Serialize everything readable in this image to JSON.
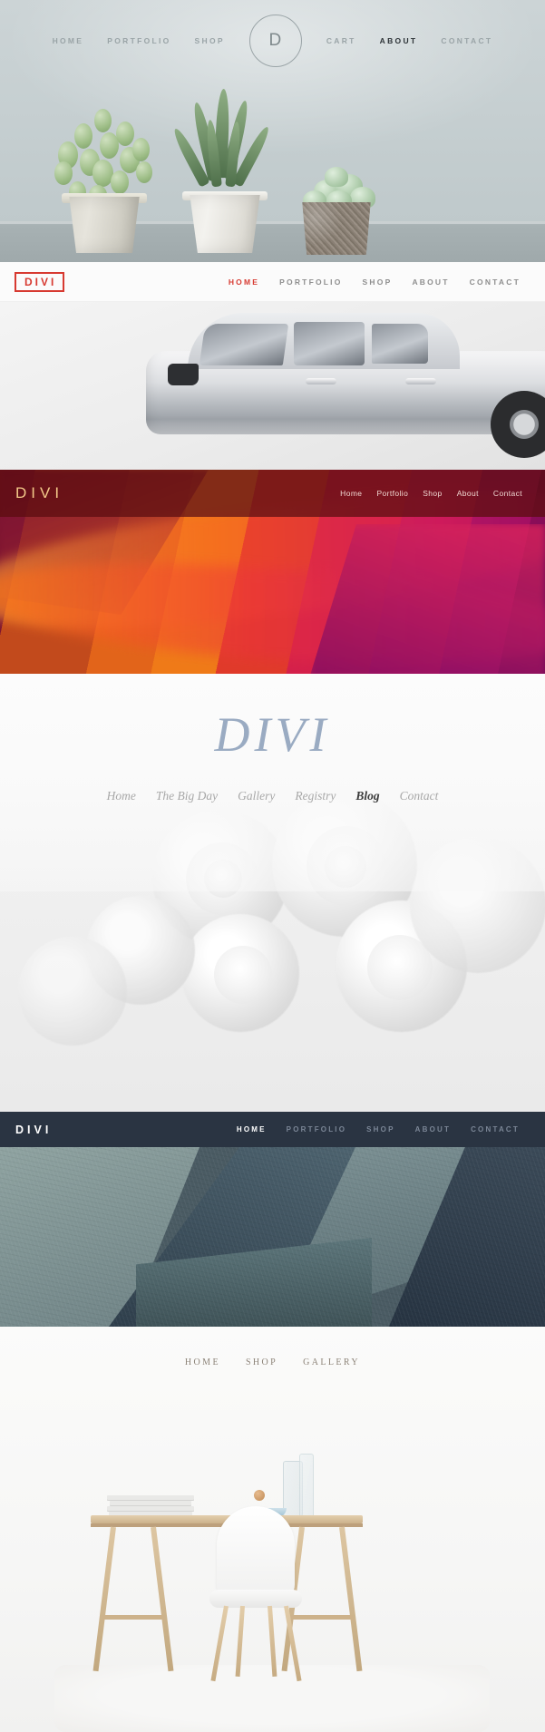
{
  "page": {
    "title": "Divi Header Styles Showcase"
  },
  "sections": [
    {
      "id": "succulents-header",
      "style": "centered-circle-logo",
      "logo": {
        "text": "D",
        "shape": "circle-outline"
      },
      "nav_left": [
        "HOME",
        "PORTFOLIO",
        "SHOP"
      ],
      "nav_right": [
        "CART",
        "ABOUT",
        "CONTACT"
      ],
      "active": "ABOUT",
      "colors": {
        "bg": "#c9d2d4",
        "text": "#9aa4a7",
        "active": "#2c3236"
      }
    },
    {
      "id": "car-header",
      "style": "white-bar-boxed-logo",
      "logo": {
        "text": "DIVI"
      },
      "nav": [
        "HOME",
        "PORTFOLIO",
        "SHOP",
        "ABOUT",
        "CONTACT"
      ],
      "active": "HOME",
      "colors": {
        "bg": "#fbfbfb",
        "accent": "#d73a31",
        "text": "#8e8e8e"
      }
    },
    {
      "id": "canyon-header",
      "style": "transparent-dark-overlay-bar",
      "logo": {
        "text": "DIVI"
      },
      "nav": [
        "Home",
        "Portfolio",
        "Shop",
        "About",
        "Contact"
      ],
      "active": "",
      "colors": {
        "bar": "#610b0e",
        "logo": "#f3c98a",
        "text": "#f0d8d2"
      }
    },
    {
      "id": "wedding-header",
      "style": "centered-serif-italic",
      "logo": {
        "text": "DIVI"
      },
      "nav": [
        "Home",
        "The Big Day",
        "Gallery",
        "Registry",
        "Blog",
        "Contact"
      ],
      "active": "Blog",
      "colors": {
        "logo": "#9aabc2",
        "text": "#a8a8a8",
        "active": "#3b3b3b"
      }
    },
    {
      "id": "geometric-header",
      "style": "solid-navy-bar",
      "logo": {
        "text": "DIVI"
      },
      "nav": [
        "HOME",
        "PORTFOLIO",
        "SHOP",
        "ABOUT",
        "CONTACT"
      ],
      "active": "HOME",
      "colors": {
        "bar": "#2a3442",
        "logo": "#ffffff",
        "text": "#7b8696",
        "active": "#ffffff"
      }
    },
    {
      "id": "desk-header",
      "style": "minimal-centered-no-logo",
      "logo": {
        "text": ""
      },
      "nav": [
        "HOME",
        "SHOP",
        "GALLERY"
      ],
      "active": "",
      "colors": {
        "bg": "#fbfbfa",
        "text": "#8c8378"
      }
    }
  ]
}
